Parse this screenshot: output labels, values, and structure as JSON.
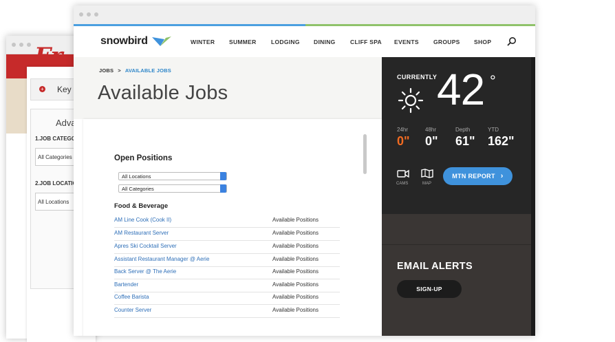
{
  "back_window": {
    "logo_text": "Fr",
    "key_label": "Key",
    "advanced_label": "Adva",
    "job_category_label": "1.JOB CATEGO",
    "job_category_value": "All Categories",
    "job_location_label": "2.JOB LOCATIO",
    "job_location_value": "All Locations"
  },
  "nav": {
    "logo": "snowbird",
    "items": [
      "WINTER",
      "SUMMER",
      "LODGING",
      "DINING",
      "CLIFF SPA",
      "EVENTS",
      "GROUPS",
      "SHOP"
    ]
  },
  "breadcrumb": {
    "root": "JOBS",
    "separator": ">",
    "current": "AVAILABLE JOBS"
  },
  "page_title": "Available Jobs",
  "jobs": {
    "heading": "Open Positions",
    "location_select": "All Locations",
    "category_select": "All Categories",
    "section": "Food & Beverage",
    "rows": [
      {
        "title": "AM Line Cook (Cook II)",
        "availability": "Available Positions"
      },
      {
        "title": "AM Restaurant Server",
        "availability": "Available Positions"
      },
      {
        "title": "Apres Ski Cocktail Server",
        "availability": "Available Positions"
      },
      {
        "title": "Assistant Restaurant Manager @ Aerie",
        "availability": "Available Positions"
      },
      {
        "title": "Back Server @ The Aerie",
        "availability": "Available Positions"
      },
      {
        "title": "Bartender",
        "availability": "Available Positions"
      },
      {
        "title": "Coffee Barista",
        "availability": "Available Positions"
      },
      {
        "title": "Counter Server",
        "availability": "Available Positions"
      }
    ]
  },
  "weather": {
    "currently_label": "CURRENTLY",
    "temperature": "42",
    "degree_symbol": "°",
    "stats": [
      {
        "label": "24hr",
        "value": "0\""
      },
      {
        "label": "48hr",
        "value": "0\""
      },
      {
        "label": "Depth",
        "value": "61\""
      },
      {
        "label": "YTD",
        "value": "162\""
      }
    ],
    "cams_label": "CAMS",
    "map_label": "MAP",
    "mtn_report_label": "MTN REPORT"
  },
  "alerts": {
    "title": "EMAIL ALERTS",
    "signup_label": "SIGN-UP"
  },
  "colors": {
    "accent_blue": "#4a9fe0",
    "accent_green": "#8fc26a",
    "link": "#2e6fb8",
    "orange": "#f26b21",
    "sidebar": "#262626",
    "brand_red": "#c62a2a"
  }
}
